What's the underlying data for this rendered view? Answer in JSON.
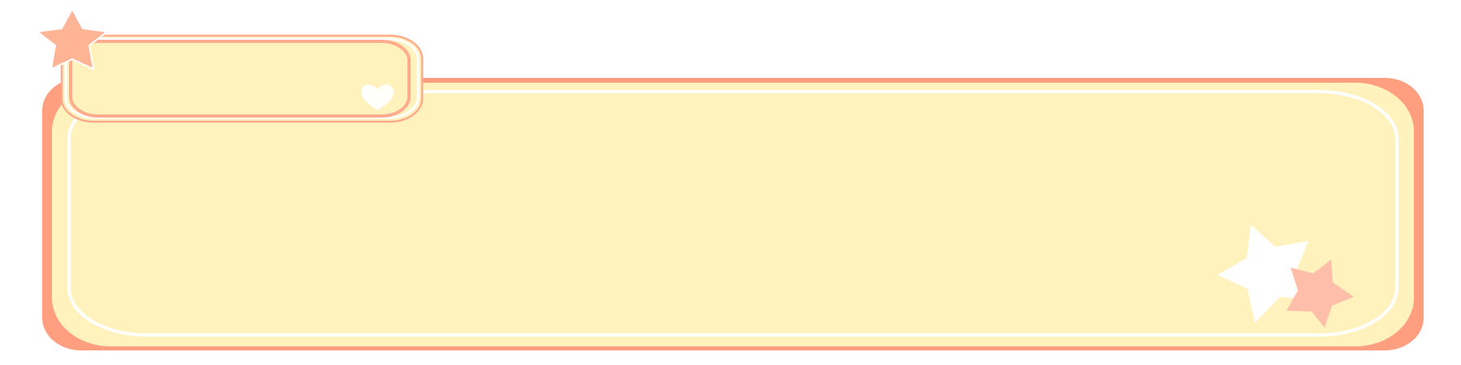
{
  "colors": {
    "background": "#ffffff",
    "panel_outer": "#ff9f80",
    "panel_fill": "#fff2bd",
    "panel_inner_line": "#ffffff",
    "tab_border": "#ffab8d",
    "tab_fill": "#fff2bd",
    "star_orange": "#ffb495",
    "star_white": "#ffffff",
    "star_pink": "#ffbeaa",
    "heart": "#ffffff"
  },
  "decorations": {
    "stars": [
      {
        "name": "top-left-star",
        "color_key": "star_orange"
      },
      {
        "name": "bottom-right-white-star",
        "color_key": "star_white"
      },
      {
        "name": "bottom-right-pink-star",
        "color_key": "star_pink"
      }
    ],
    "heart_icon": "heart-icon"
  }
}
